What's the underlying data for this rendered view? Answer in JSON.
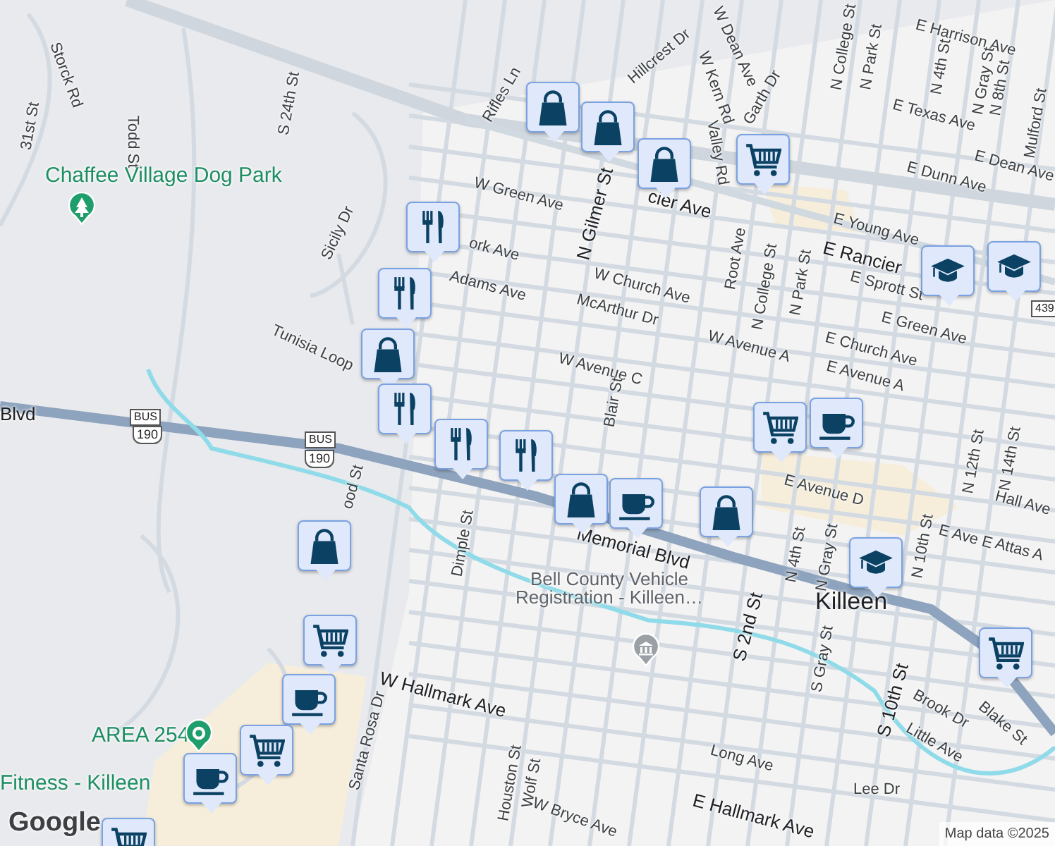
{
  "map": {
    "labels": [
      {
        "text": "Storck Rd",
        "kind": "street"
      },
      {
        "text": "31st St",
        "kind": "street"
      },
      {
        "text": "Todd St",
        "kind": "street"
      },
      {
        "text": "S 24th St",
        "kind": "street"
      },
      {
        "text": "Rifles Ln",
        "kind": "street"
      },
      {
        "text": "Sicily Dr",
        "kind": "street"
      },
      {
        "text": "Tunisia Loop",
        "kind": "street"
      },
      {
        "text": "W Green Ave",
        "kind": "street"
      },
      {
        "text": "ork Ave",
        "kind": "street"
      },
      {
        "text": "Adams Ave",
        "kind": "street"
      },
      {
        "text": "Hillcrest Dr",
        "kind": "street"
      },
      {
        "text": "W Dean Ave",
        "kind": "street"
      },
      {
        "text": "W Kern Rd",
        "kind": "street"
      },
      {
        "text": "Garth Dr",
        "kind": "street"
      },
      {
        "text": "Valley Rd",
        "kind": "street"
      },
      {
        "text": "N College St",
        "kind": "street"
      },
      {
        "text": "N Park St",
        "kind": "street"
      },
      {
        "text": "E Harrison Ave",
        "kind": "street"
      },
      {
        "text": "N 4th St",
        "kind": "street"
      },
      {
        "text": "N Gray St",
        "kind": "street"
      },
      {
        "text": "N 8th St",
        "kind": "street"
      },
      {
        "text": "Mulford St",
        "kind": "street"
      },
      {
        "text": "E Texas Ave",
        "kind": "street"
      },
      {
        "text": "E Dean Ave",
        "kind": "street"
      },
      {
        "text": "E Dunn Ave",
        "kind": "street"
      },
      {
        "text": "cier Ave",
        "kind": "major"
      },
      {
        "text": "N Gilmer St",
        "kind": "major"
      },
      {
        "text": "E Young Ave",
        "kind": "street"
      },
      {
        "text": "E Rancier",
        "kind": "major"
      },
      {
        "text": "E Sprott St",
        "kind": "street"
      },
      {
        "text": "W Church Ave",
        "kind": "street"
      },
      {
        "text": "McArthur Dr",
        "kind": "street"
      },
      {
        "text": "Root Ave",
        "kind": "street"
      },
      {
        "text": "N College St",
        "kind": "street"
      },
      {
        "text": "N Park St",
        "kind": "street"
      },
      {
        "text": "E Green Ave",
        "kind": "street"
      },
      {
        "text": "W Avenue A",
        "kind": "street"
      },
      {
        "text": "E Church Ave",
        "kind": "street"
      },
      {
        "text": "W Avenue C",
        "kind": "street"
      },
      {
        "text": "E Avenue A",
        "kind": "street"
      },
      {
        "text": "Blair St",
        "kind": "street"
      },
      {
        "text": "E Avenue D",
        "kind": "street"
      },
      {
        "text": "Hall Ave",
        "kind": "street"
      },
      {
        "text": "E Ave E",
        "kind": "street"
      },
      {
        "text": "Attas A",
        "kind": "street"
      },
      {
        "text": "N 12th St",
        "kind": "street"
      },
      {
        "text": "N 14th St",
        "kind": "street"
      },
      {
        "text": "Memorial Blvd",
        "kind": "major"
      },
      {
        "text": "Blvd",
        "kind": "major"
      },
      {
        "text": "N 4th St",
        "kind": "street"
      },
      {
        "text": "N Gray St",
        "kind": "street"
      },
      {
        "text": "N 10th St",
        "kind": "street"
      },
      {
        "text": "Killeen",
        "kind": "city"
      },
      {
        "text": "S 2nd St",
        "kind": "major"
      },
      {
        "text": "S Gray St",
        "kind": "street"
      },
      {
        "text": "S 10th St",
        "kind": "major"
      },
      {
        "text": "Brook Dr",
        "kind": "street"
      },
      {
        "text": "Blake St",
        "kind": "street"
      },
      {
        "text": "Little Ave",
        "kind": "street"
      },
      {
        "text": "Long Ave",
        "kind": "street"
      },
      {
        "text": "E Hallmark Ave",
        "kind": "major"
      },
      {
        "text": "Lee Dr",
        "kind": "street"
      },
      {
        "text": "W Hallmark Ave",
        "kind": "major"
      },
      {
        "text": "Santa Rosa Dr",
        "kind": "street"
      },
      {
        "text": "Houston St",
        "kind": "street"
      },
      {
        "text": "Wolf St",
        "kind": "street"
      },
      {
        "text": "W Bryce Ave",
        "kind": "street"
      },
      {
        "text": "Dimple St",
        "kind": "street"
      },
      {
        "text": "ood St",
        "kind": "street"
      },
      {
        "text": "Chaffee Village Dog Park",
        "kind": "park"
      },
      {
        "text": "AREA 254",
        "kind": "park"
      },
      {
        "text": "Fitness - Killeen",
        "kind": "park"
      },
      {
        "text": "Bell County Vehicle Registration - Killeen…",
        "kind": "poi"
      }
    ],
    "shields": [
      {
        "text": "BUS",
        "kind": "banner"
      },
      {
        "text": "190",
        "kind": "us"
      },
      {
        "text": "BUS",
        "kind": "banner"
      },
      {
        "text": "190",
        "kind": "us"
      },
      {
        "text": "439",
        "kind": "state"
      }
    ],
    "markers": [
      {
        "kind": "shopping"
      },
      {
        "kind": "shopping"
      },
      {
        "kind": "shopping"
      },
      {
        "kind": "grocery"
      },
      {
        "kind": "school"
      },
      {
        "kind": "school"
      },
      {
        "kind": "restaurant"
      },
      {
        "kind": "restaurant"
      },
      {
        "kind": "shopping"
      },
      {
        "kind": "restaurant"
      },
      {
        "kind": "restaurant"
      },
      {
        "kind": "restaurant"
      },
      {
        "kind": "shopping"
      },
      {
        "kind": "cafe"
      },
      {
        "kind": "shopping"
      },
      {
        "kind": "grocery"
      },
      {
        "kind": "cafe"
      },
      {
        "kind": "school"
      },
      {
        "kind": "grocery"
      },
      {
        "kind": "shopping"
      },
      {
        "kind": "grocery"
      },
      {
        "kind": "cafe"
      },
      {
        "kind": "grocery"
      },
      {
        "kind": "cafe"
      },
      {
        "kind": "grocery"
      }
    ],
    "logo": "Google",
    "attribution": "Map data ©2025"
  }
}
